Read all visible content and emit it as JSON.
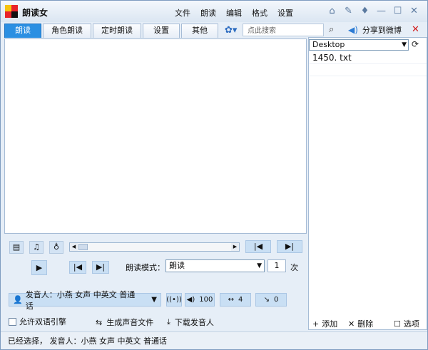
{
  "app": {
    "title": "朗读女"
  },
  "menu": [
    "文件",
    "朗读",
    "编辑",
    "格式",
    "设置"
  ],
  "tabs": [
    {
      "label": "朗读",
      "active": true
    },
    {
      "label": "角色朗读",
      "active": false
    },
    {
      "label": "定时朗读",
      "active": false
    },
    {
      "label": "设置",
      "active": false
    },
    {
      "label": "其他",
      "active": false
    }
  ],
  "search": {
    "placeholder": "点此搜索"
  },
  "share": {
    "label": "分享到微博"
  },
  "file_panel": {
    "folder": "Desktop",
    "files": [
      "1450. txt"
    ]
  },
  "playback": {
    "mode_label": "朗读模式：",
    "mode_value": "朗读",
    "times_value": "1",
    "times_unit": "次"
  },
  "voice": {
    "label": "发音人：小燕 女声 中英文 普通话",
    "volume": "100",
    "speed": "4",
    "pitch": "0"
  },
  "options": {
    "dual_engine": "允许双语引擎",
    "generate": "生成声音文件",
    "download": "下载发音人"
  },
  "list_actions": {
    "add": "添加",
    "delete": "删除",
    "options": "选项"
  },
  "status": {
    "text": "已经选择， 发音人：小燕 女声 中英文 普通话"
  },
  "colors": {
    "active_tab": "#2b8fe2",
    "close": "#d21a1a",
    "button_bg": "#c9dff4"
  }
}
